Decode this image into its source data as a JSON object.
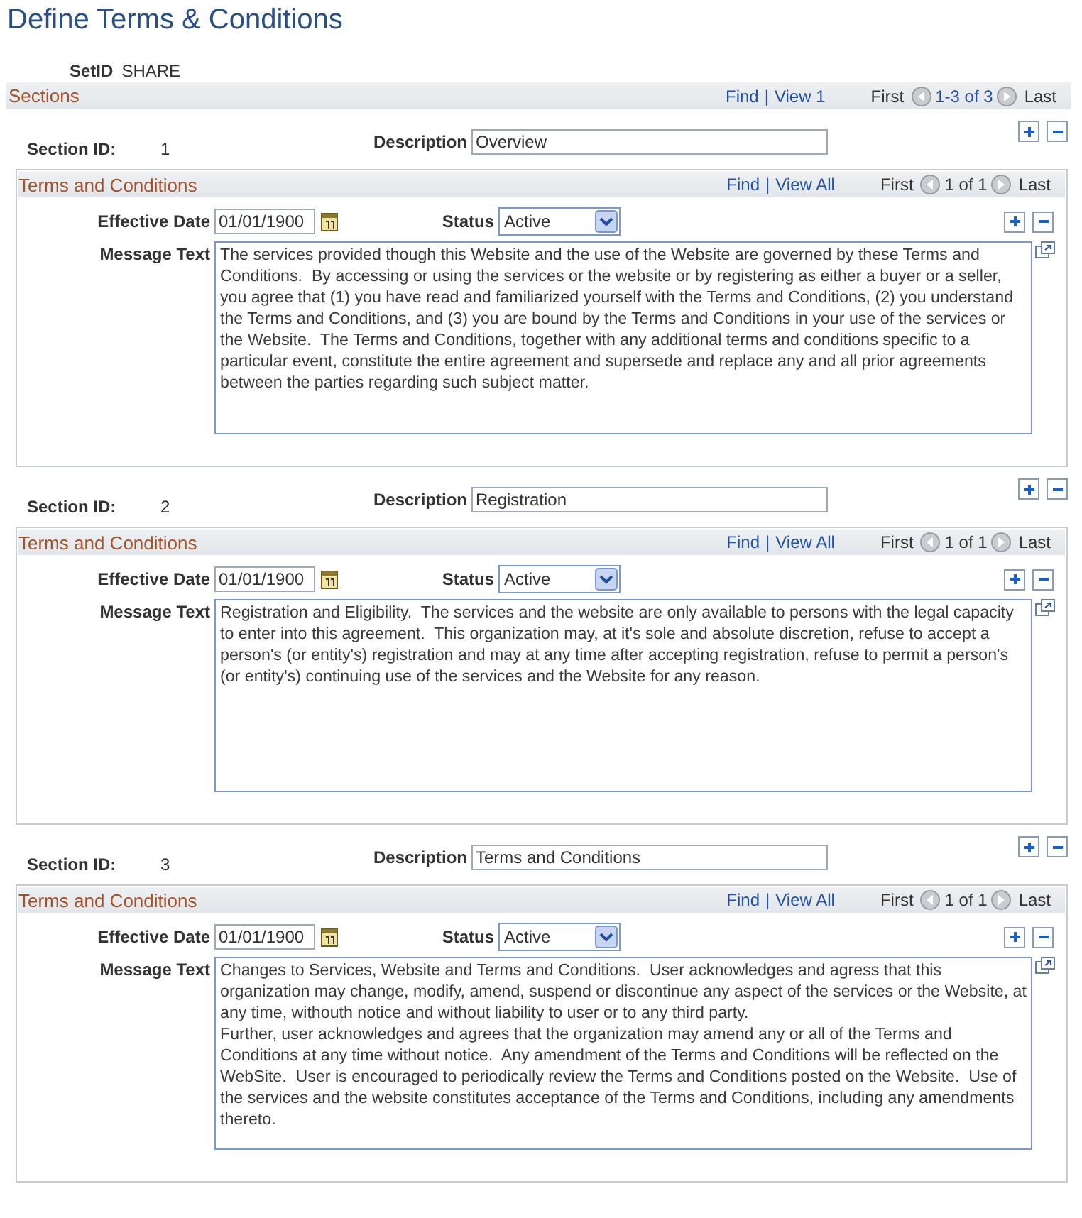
{
  "title": "Define Terms & Conditions",
  "setid": {
    "label": "SetID",
    "value": "SHARE"
  },
  "sections_bar": {
    "title": "Sections",
    "find": "Find",
    "separator": "|",
    "view": "View 1",
    "first": "First",
    "range": "1-3 of 3",
    "last": "Last"
  },
  "sections": [
    {
      "id_label": "Section ID:",
      "id": "1",
      "description_label": "Description",
      "description": "Overview",
      "terms": {
        "title": "Terms and Conditions",
        "find": "Find",
        "separator": "|",
        "view": "View All",
        "first": "First",
        "range": "1 of 1",
        "last": "Last",
        "effective_date_label": "Effective Date",
        "effective_date": "01/01/1900",
        "status_label": "Status",
        "status": "Active",
        "message_label": "Message Text",
        "message": "The services provided though this Website and the use of the Website are governed by these Terms and Conditions.  By accessing or using the services or the website or by registering as either a buyer or a seller, you agree that (1) you have read and familiarized yourself with the Terms and Conditions, (2) you understand the Terms and Conditions, and (3) you are bound by the Terms and Conditions in your use of the services or the Website.  The Terms and Conditions, together with any additional terms and conditions specific to a particular event, constitute the entire agreement and supersede and replace any and all prior agreements between the parties regarding such subject matter."
      }
    },
    {
      "id_label": "Section ID:",
      "id": "2",
      "description_label": "Description",
      "description": "Registration",
      "terms": {
        "title": "Terms and Conditions",
        "find": "Find",
        "separator": "|",
        "view": "View All",
        "first": "First",
        "range": "1 of 1",
        "last": "Last",
        "effective_date_label": "Effective Date",
        "effective_date": "01/01/1900",
        "status_label": "Status",
        "status": "Active",
        "message_label": "Message Text",
        "message": "Registration and Eligibility.  The services and the website are only available to persons with the legal capacity to enter into this agreement.  This organization may, at it's sole and absolute discretion, refuse to accept a person's (or entity's) registration and may at any time after accepting registration, refuse to permit a person's (or entity's) continuing use of the services and the Website for any reason."
      }
    },
    {
      "id_label": "Section ID:",
      "id": "3",
      "description_label": "Description",
      "description": "Terms and Conditions",
      "terms": {
        "title": "Terms and Conditions",
        "find": "Find",
        "separator": "|",
        "view": "View All",
        "first": "First",
        "range": "1 of 1",
        "last": "Last",
        "effective_date_label": "Effective Date",
        "effective_date": "01/01/1900",
        "status_label": "Status",
        "status": "Active",
        "message_label": "Message Text",
        "message": "Changes to Services, Website and Terms and Conditions.  User acknowledges and agress that this organization may change, modify, amend, suspend or discontinue any aspect of the services or the Website, at any time, withouth notice and without liability to user or to any third party.\nFurther, user acknowledges and agrees that the organization may amend any or all of the Terms and Conditions at any time without notice.  Any amendment of the Terms and Conditions will be reflected on the WebSite.  User is encouraged to periodically review the Terms and Conditions posted on the Website.  Use of the services and the website constitutes acceptance of the Terms and Conditions, including any amendments thereto."
      }
    }
  ]
}
